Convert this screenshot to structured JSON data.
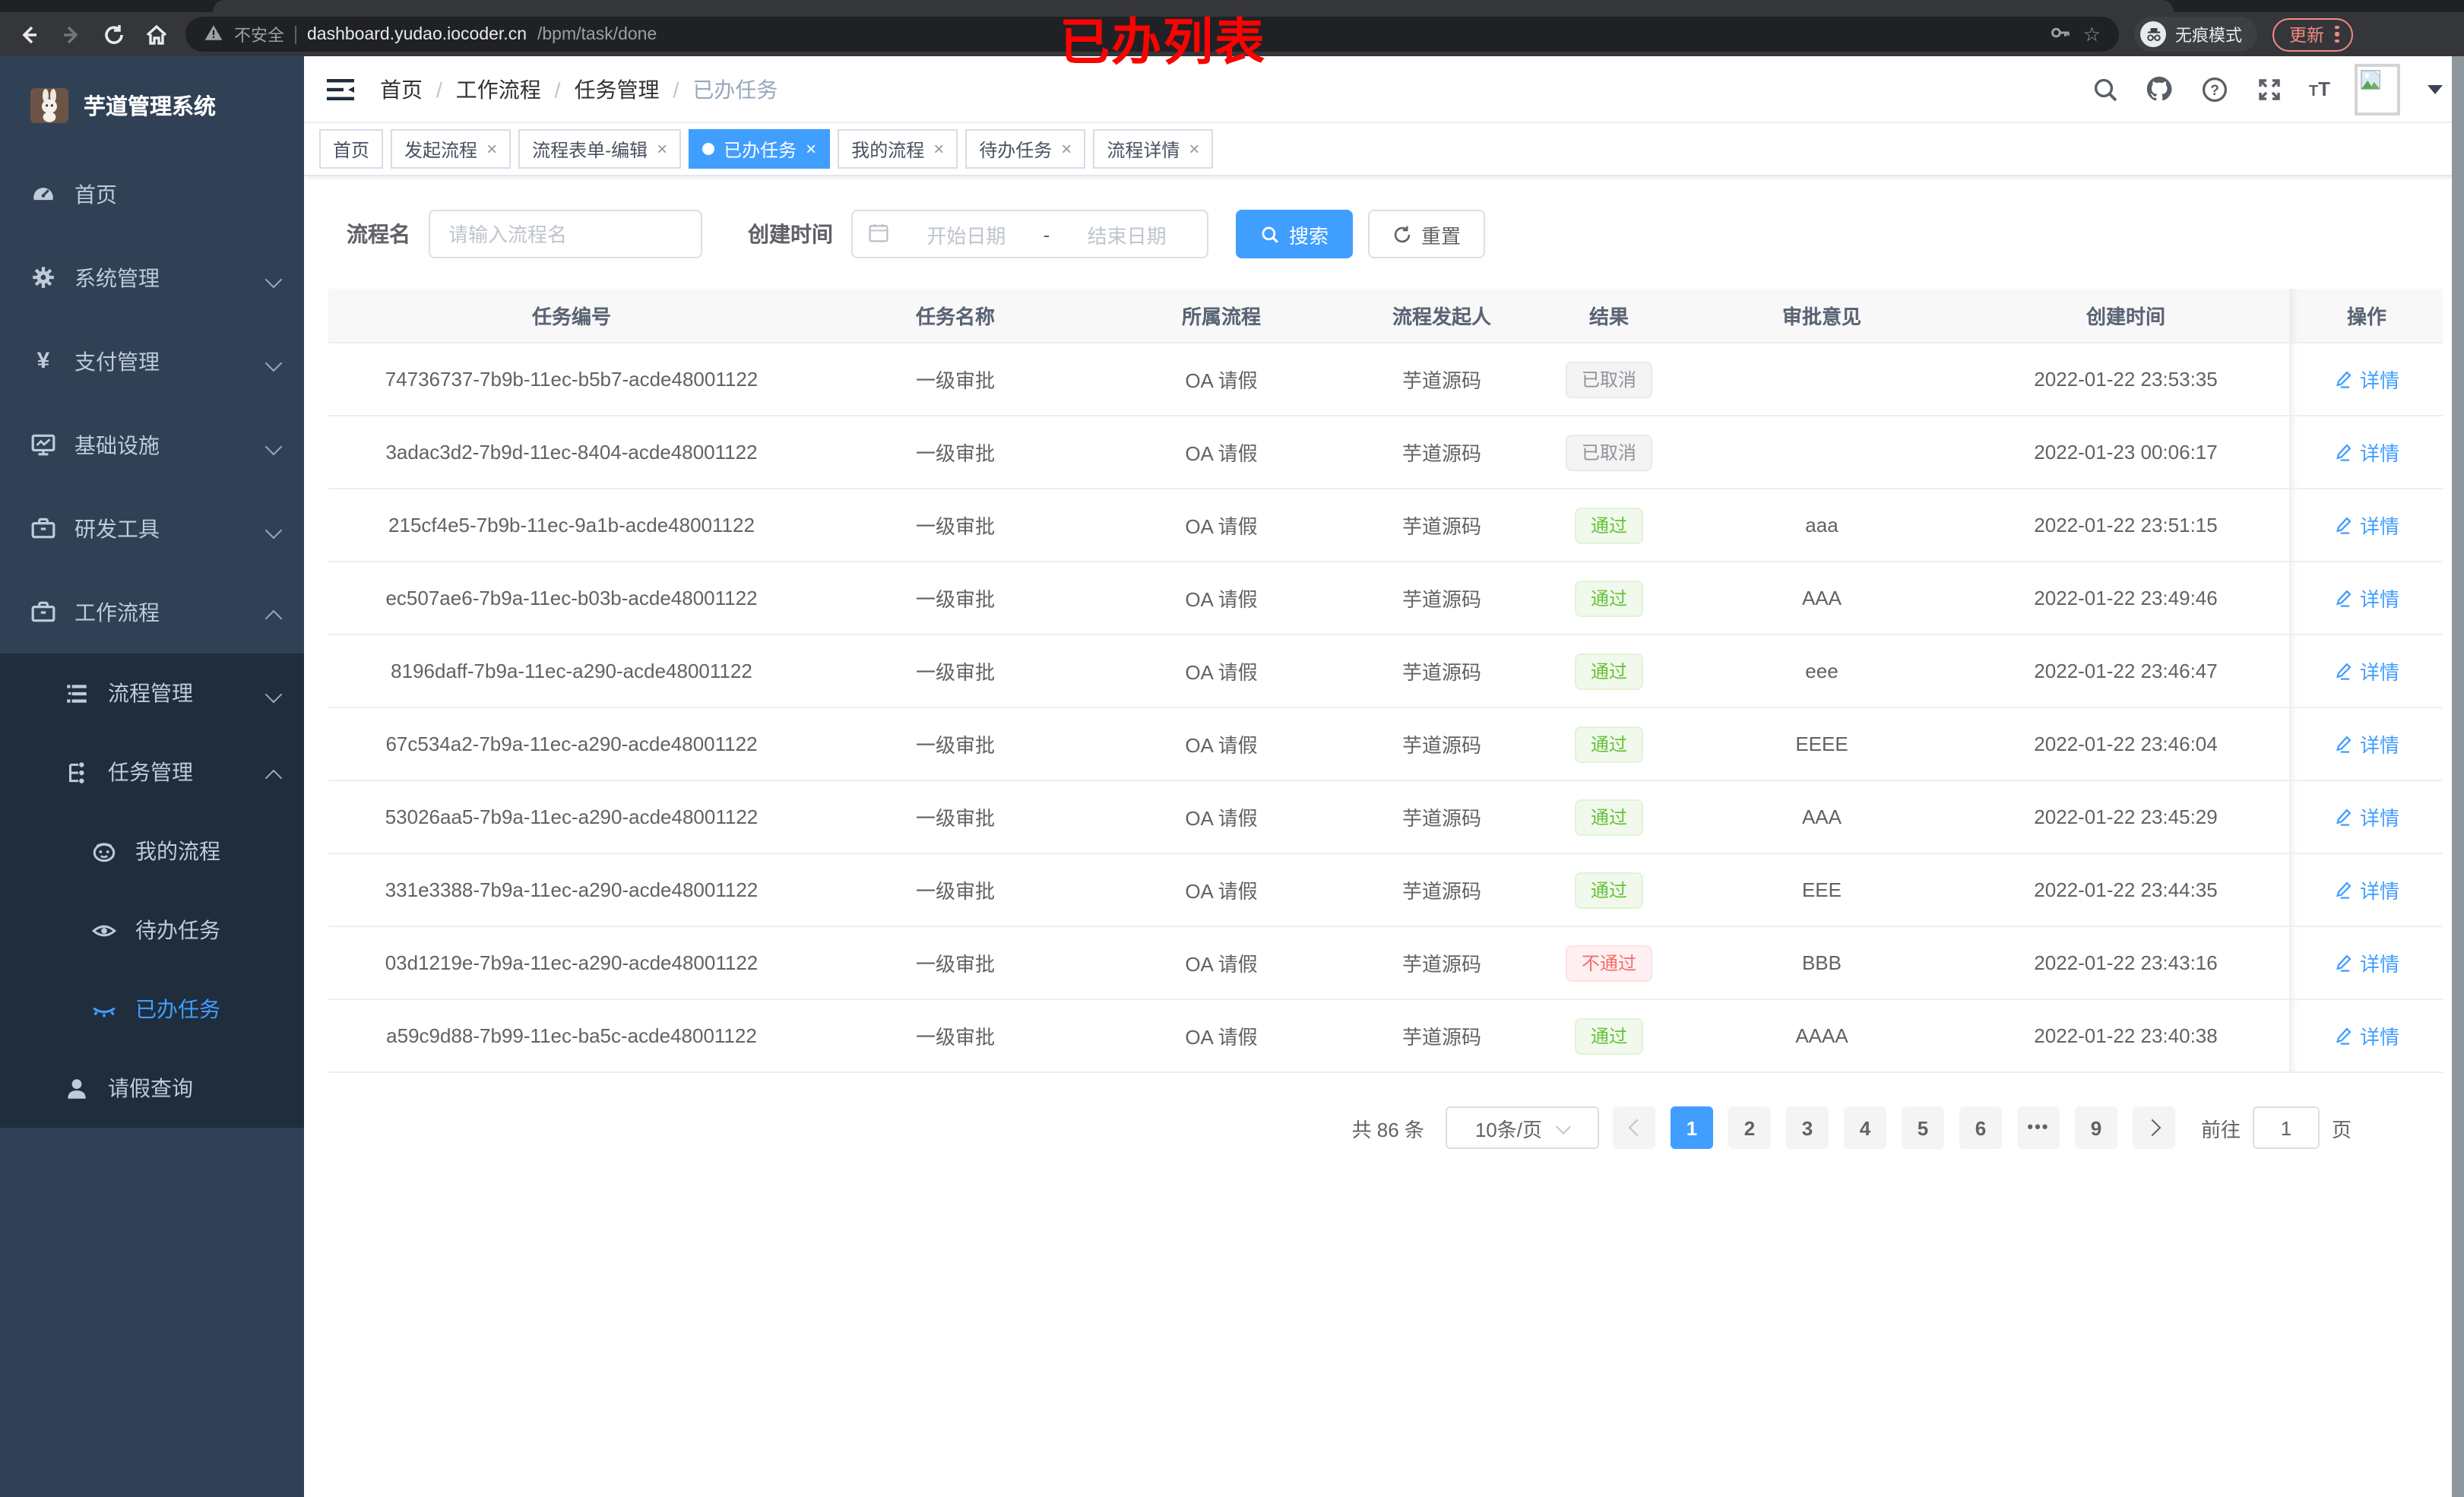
{
  "colors": {
    "accent": "#409eff",
    "success": "#67c23a",
    "danger": "#f56c6c",
    "info": "#909399",
    "sidebar_bg": "#304156",
    "submenu_bg": "#1f2d3d",
    "annotation_red": "#fc0303",
    "chrome_update": "#f28b82"
  },
  "browser": {
    "security_label": "不安全",
    "url_host": "dashboard.yudao.iocoder.cn",
    "url_path": "/bpm/task/done",
    "incognito_label": "无痕模式",
    "update_label": "更新"
  },
  "annotation": {
    "title": "已办列表"
  },
  "sidebar": {
    "logo_title": "芋道管理系统",
    "items": [
      {
        "label": "首页",
        "icon": "dashboard-icon",
        "level": 1,
        "expandable": false,
        "active": false
      },
      {
        "label": "系统管理",
        "icon": "gear-icon",
        "level": 1,
        "expandable": true,
        "expanded": false,
        "active": false
      },
      {
        "label": "支付管理",
        "icon": "yen-icon",
        "level": 1,
        "expandable": true,
        "expanded": false,
        "active": false
      },
      {
        "label": "基础设施",
        "icon": "monitor-icon",
        "level": 1,
        "expandable": true,
        "expanded": false,
        "active": false
      },
      {
        "label": "研发工具",
        "icon": "toolbox-icon",
        "level": 1,
        "expandable": true,
        "expanded": false,
        "active": false
      },
      {
        "label": "工作流程",
        "icon": "toolbox-icon",
        "level": 1,
        "expandable": true,
        "expanded": true,
        "active": false
      },
      {
        "label": "流程管理",
        "icon": "flow-list-icon",
        "level": 2,
        "expandable": true,
        "expanded": false,
        "active": false
      },
      {
        "label": "任务管理",
        "icon": "tree-icon",
        "level": 2,
        "expandable": true,
        "expanded": true,
        "active": false
      },
      {
        "label": "我的流程",
        "icon": "face-icon",
        "level": 3,
        "expandable": false,
        "active": false
      },
      {
        "label": "待办任务",
        "icon": "eye-open-icon",
        "level": 3,
        "expandable": false,
        "active": false
      },
      {
        "label": "已办任务",
        "icon": "eye-closed-icon",
        "level": 3,
        "expandable": false,
        "active": true
      },
      {
        "label": "请假查询",
        "icon": "person-icon",
        "level": 2,
        "expandable": false,
        "active": false
      }
    ]
  },
  "breadcrumb": {
    "items": [
      "首页",
      "工作流程",
      "任务管理",
      "已办任务"
    ]
  },
  "tabs": {
    "items": [
      {
        "label": "首页",
        "closable": false,
        "active": false
      },
      {
        "label": "发起流程",
        "closable": true,
        "active": false
      },
      {
        "label": "流程表单-编辑",
        "closable": true,
        "active": false
      },
      {
        "label": "已办任务",
        "closable": true,
        "active": true
      },
      {
        "label": "我的流程",
        "closable": true,
        "active": false
      },
      {
        "label": "待办任务",
        "closable": true,
        "active": false
      },
      {
        "label": "流程详情",
        "closable": true,
        "active": false
      }
    ]
  },
  "filters": {
    "name_label": "流程名",
    "name_placeholder": "请输入流程名",
    "date_label": "创建时间",
    "date_start_placeholder": "开始日期",
    "date_separator": "-",
    "date_end_placeholder": "结束日期",
    "search_label": "搜索",
    "reset_label": "重置"
  },
  "table": {
    "columns": [
      "任务编号",
      "任务名称",
      "所属流程",
      "流程发起人",
      "结果",
      "审批意见",
      "创建时间",
      "操作"
    ],
    "action_label": "详情",
    "rows": [
      {
        "id": "74736737-7b9b-11ec-b5b7-acde48001122",
        "name": "一级审批",
        "process": "OA 请假",
        "starter": "芋道源码",
        "result": "已取消",
        "result_type": "info",
        "comment": "",
        "time": "2022-01-22 23:53:35"
      },
      {
        "id": "3adac3d2-7b9d-11ec-8404-acde48001122",
        "name": "一级审批",
        "process": "OA 请假",
        "starter": "芋道源码",
        "result": "已取消",
        "result_type": "info",
        "comment": "",
        "time": "2022-01-23 00:06:17"
      },
      {
        "id": "215cf4e5-7b9b-11ec-9a1b-acde48001122",
        "name": "一级审批",
        "process": "OA 请假",
        "starter": "芋道源码",
        "result": "通过",
        "result_type": "success",
        "comment": "aaa",
        "time": "2022-01-22 23:51:15"
      },
      {
        "id": "ec507ae6-7b9a-11ec-b03b-acde48001122",
        "name": "一级审批",
        "process": "OA 请假",
        "starter": "芋道源码",
        "result": "通过",
        "result_type": "success",
        "comment": "AAA",
        "time": "2022-01-22 23:49:46"
      },
      {
        "id": "8196daff-7b9a-11ec-a290-acde48001122",
        "name": "一级审批",
        "process": "OA 请假",
        "starter": "芋道源码",
        "result": "通过",
        "result_type": "success",
        "comment": "eee",
        "time": "2022-01-22 23:46:47"
      },
      {
        "id": "67c534a2-7b9a-11ec-a290-acde48001122",
        "name": "一级审批",
        "process": "OA 请假",
        "starter": "芋道源码",
        "result": "通过",
        "result_type": "success",
        "comment": "EEEE",
        "time": "2022-01-22 23:46:04"
      },
      {
        "id": "53026aa5-7b9a-11ec-a290-acde48001122",
        "name": "一级审批",
        "process": "OA 请假",
        "starter": "芋道源码",
        "result": "通过",
        "result_type": "success",
        "comment": "AAA",
        "time": "2022-01-22 23:45:29"
      },
      {
        "id": "331e3388-7b9a-11ec-a290-acde48001122",
        "name": "一级审批",
        "process": "OA 请假",
        "starter": "芋道源码",
        "result": "通过",
        "result_type": "success",
        "comment": "EEE",
        "time": "2022-01-22 23:44:35"
      },
      {
        "id": "03d1219e-7b9a-11ec-a290-acde48001122",
        "name": "一级审批",
        "process": "OA 请假",
        "starter": "芋道源码",
        "result": "不通过",
        "result_type": "danger",
        "comment": "BBB",
        "time": "2022-01-22 23:43:16"
      },
      {
        "id": "a59c9d88-7b99-11ec-ba5c-acde48001122",
        "name": "一级审批",
        "process": "OA 请假",
        "starter": "芋道源码",
        "result": "通过",
        "result_type": "success",
        "comment": "AAAA",
        "time": "2022-01-22 23:40:38"
      }
    ]
  },
  "pagination": {
    "total_label": "共 86 条",
    "page_size_label": "10条/页",
    "pages": [
      "1",
      "2",
      "3",
      "4",
      "5",
      "6",
      "•••",
      "9"
    ],
    "active_page": "1",
    "goto_label": "前往",
    "goto_value": "1",
    "goto_suffix": "页"
  }
}
